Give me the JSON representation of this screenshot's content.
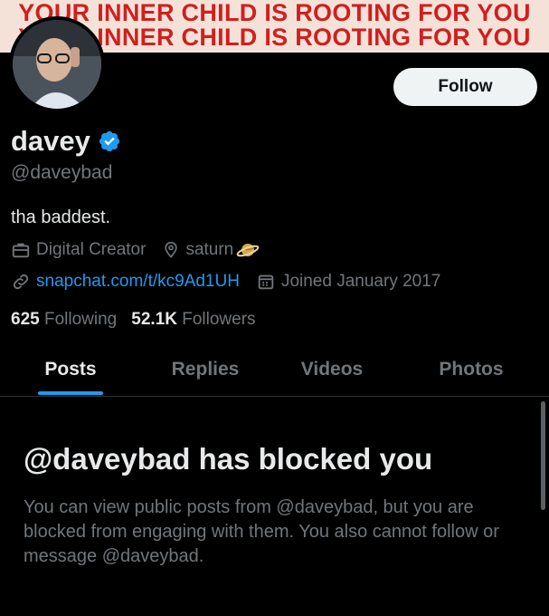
{
  "banner": {
    "line1": "YOUR INNER CHILD IS ROOTING FOR YOU",
    "line2": "YOUR INNER CHILD IS ROOTING FOR YOU"
  },
  "profile": {
    "display_name": "davey",
    "handle": "@daveybad",
    "bio": "tha baddest.",
    "category": "Digital Creator",
    "location": "saturn",
    "website": "snapchat.com/t/kc9Ad1UH",
    "joined": "Joined January 2017",
    "following_count": "625",
    "following_label": "Following",
    "followers_count": "52.1K",
    "followers_label": "Followers"
  },
  "actions": {
    "follow_label": "Follow"
  },
  "tabs": [
    {
      "label": "Posts",
      "active": true
    },
    {
      "label": "Replies",
      "active": false
    },
    {
      "label": "Videos",
      "active": false
    },
    {
      "label": "Photos",
      "active": false
    }
  ],
  "blocked": {
    "title": "@daveybad has blocked you",
    "message": "You can view public posts from @daveybad, but you are blocked from engaging with them. You also cannot follow or message @daveybad."
  },
  "icons": {
    "verified": "verified-badge-icon",
    "category": "briefcase-icon",
    "location": "location-pin-icon",
    "link": "link-icon",
    "joined": "calendar-icon",
    "location_emoji": "planet-icon"
  },
  "colors": {
    "accent": "#1d9bf0",
    "background": "#000000",
    "banner_bg": "#f4e2d8",
    "banner_text": "#d01f1f",
    "muted_text": "#71767b",
    "primary_text": "#e7e9ea"
  }
}
